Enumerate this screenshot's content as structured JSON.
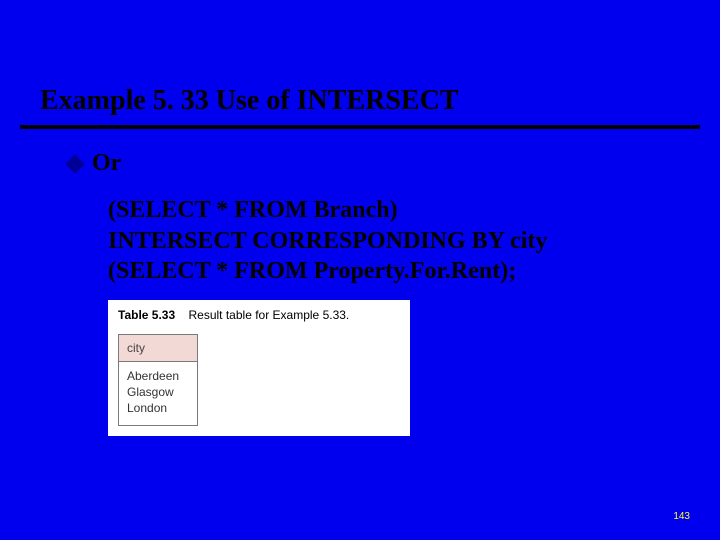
{
  "title": "Example 5. 33  Use of INTERSECT",
  "bullet": "Or",
  "code": {
    "line1": "(SELECT * FROM Branch)",
    "line2": "INTERSECT CORRESPONDING BY city",
    "line3": "(SELECT * FROM Property.For.Rent);"
  },
  "table": {
    "caption_bold": "Table 5.33",
    "caption_rest": "Result table for Example 5.33.",
    "header": "city",
    "rows": [
      "Aberdeen",
      "Glasgow",
      "London"
    ]
  },
  "page_number": "143"
}
